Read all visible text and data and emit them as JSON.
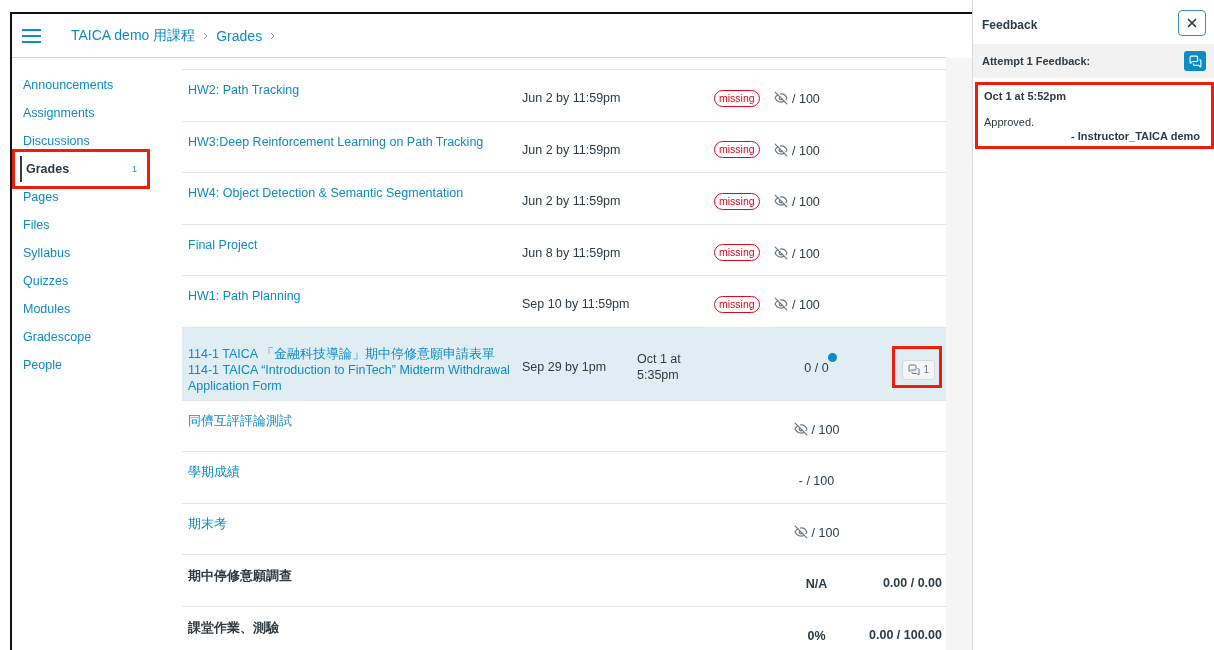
{
  "header": {
    "breadcrumbs": [
      "TAICA demo 用課程",
      "Grades"
    ]
  },
  "sidebar": {
    "items": [
      {
        "label": "Announcements",
        "selected": false,
        "highlighted": false
      },
      {
        "label": "Assignments",
        "selected": false,
        "highlighted": false
      },
      {
        "label": "Discussions",
        "selected": false,
        "highlighted": false
      },
      {
        "label": "Grades",
        "selected": true,
        "badge": "1",
        "highlighted": true
      },
      {
        "label": "Pages",
        "selected": false,
        "highlighted": false
      },
      {
        "label": "Files",
        "selected": false,
        "highlighted": false
      },
      {
        "label": "Syllabus",
        "selected": false,
        "highlighted": false
      },
      {
        "label": "Quizzes",
        "selected": false,
        "highlighted": false
      },
      {
        "label": "Modules",
        "selected": false,
        "highlighted": false
      },
      {
        "label": "Gradescope",
        "selected": false,
        "highlighted": false
      },
      {
        "label": "People",
        "selected": false,
        "highlighted": false
      }
    ]
  },
  "grades": {
    "rows": [
      {
        "kind": "assignment",
        "title": "HW2: Path Tracking",
        "due": "Jun 2 by 11:59pm",
        "status": "missing",
        "score_hidden": true,
        "score": "/ 100",
        "selected": false
      },
      {
        "kind": "assignment",
        "title": "HW3:Deep Reinforcement Learning on Path Tracking",
        "due": "Jun 2 by 11:59pm",
        "status": "missing",
        "score_hidden": true,
        "score": "/ 100",
        "selected": false
      },
      {
        "kind": "assignment",
        "title": "HW4: Object Detection & Semantic Segmentation",
        "due": "Jun 2 by 11:59pm",
        "status": "missing",
        "score_hidden": true,
        "score": "/ 100",
        "selected": false
      },
      {
        "kind": "assignment",
        "title": "Final Project",
        "due": "Jun 8 by 11:59pm",
        "status": "missing",
        "score_hidden": true,
        "score": "/ 100",
        "selected": false
      },
      {
        "kind": "assignment",
        "title": "HW1: Path Planning",
        "due": "Sep 10 by 11:59pm",
        "status": "missing",
        "score_hidden": true,
        "score": "/ 100",
        "selected": false
      },
      {
        "kind": "assignment",
        "title": "114-1 TAICA 「金融科技導論」期中停修意願申請表單 114-1 TAICA “Introduction to FinTech” Midterm Withdrawal Application Form",
        "due": "Sep 29 by 1pm",
        "submitted": "Oct 1 at 5:35pm",
        "score_hidden": false,
        "score": "0 / 0",
        "unread": true,
        "comments": "1",
        "comments_highlighted": true,
        "selected": true
      },
      {
        "kind": "assignment",
        "title": "同儕互評評論測試",
        "score_hidden": true,
        "score": "/ 100",
        "selected": false
      },
      {
        "kind": "assignment",
        "title": "學期成績",
        "score_hidden": false,
        "score": "- / 100",
        "selected": false
      },
      {
        "kind": "assignment",
        "title": "期末考",
        "score_hidden": true,
        "score": "/ 100",
        "selected": false
      },
      {
        "kind": "group",
        "title": "期中停修意願調查",
        "score": "N/A",
        "total": "0.00 / 0.00",
        "selected": false
      },
      {
        "kind": "group",
        "title": "課堂作業、測驗",
        "score": "0%",
        "total": "0.00 / 100.00",
        "selected": false
      }
    ]
  },
  "feedback": {
    "title": "Feedback",
    "attempt": "Attempt 1 Feedback:",
    "comments": [
      {
        "date": "Oct 1 at 5:52pm",
        "text": "Approved.",
        "author": "- Instructor_TAICA demo",
        "highlighted": true
      }
    ]
  }
}
